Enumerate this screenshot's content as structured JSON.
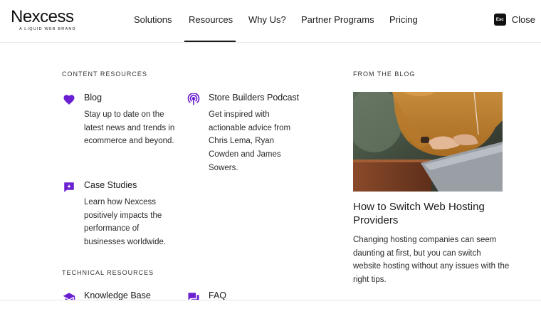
{
  "brand": {
    "name": "Nexcess",
    "tagline": "A LIQUID WEB BRAND"
  },
  "nav": {
    "items": [
      "Solutions",
      "Resources",
      "Why Us?",
      "Partner Programs",
      "Pricing"
    ],
    "active": "Resources",
    "esc_key": "Esc",
    "close_label": "Close"
  },
  "content_resources": {
    "heading": "CONTENT RESOURCES",
    "items": [
      {
        "title": "Blog",
        "desc": "Stay up to date on the latest news and trends in ecommerce and beyond.",
        "icon": "heart-icon"
      },
      {
        "title": "Store Builders Podcast",
        "desc": "Get inspired with actionable advice from Chris Lema, Ryan Cowden and James Sowers.",
        "icon": "podcast-icon"
      },
      {
        "title": "Case Studies",
        "desc": "Learn how Nexcess positively impacts the performance of businesses worldwide.",
        "icon": "sparkle-chat-icon"
      }
    ]
  },
  "technical_resources": {
    "heading": "TECHNICAL RESOURCES",
    "items": [
      {
        "title": "Knowledge Base",
        "icon": "graduation-cap-icon"
      },
      {
        "title": "FAQ",
        "icon": "chat-bubbles-icon"
      }
    ]
  },
  "blog": {
    "heading": "FROM THE BLOG",
    "title": "How to Switch Web Hosting Providers",
    "desc": "Changing hosting companies can seem daunting at first, but you can switch website hosting without any issues with the right tips."
  },
  "colors": {
    "accent": "#6a1fd1",
    "text": "#1a1a1a"
  }
}
